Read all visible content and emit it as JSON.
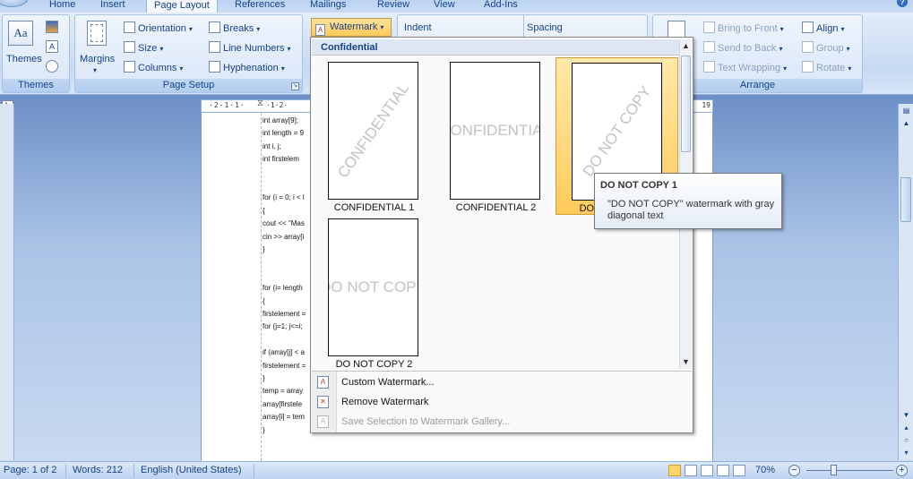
{
  "tabs": [
    "Home",
    "Insert",
    "Page Layout",
    "References",
    "Mailings",
    "Review",
    "View",
    "Add-Ins"
  ],
  "active_tab": "Page Layout",
  "ribbon": {
    "themes": {
      "button_label": "Themes",
      "group_label": "Themes"
    },
    "page_setup": {
      "margins_label": "Margins",
      "orientation_label": "Orientation",
      "size_label": "Size",
      "columns_label": "Columns",
      "breaks_label": "Breaks",
      "line_numbers_label": "Line Numbers",
      "hyphenation_label": "Hyphenation",
      "group_label": "Page Setup"
    },
    "page_background": {
      "watermark_label": "Watermark"
    },
    "paragraph": {
      "indent_label": "Indent",
      "spacing_label": "Spacing"
    },
    "arrange": {
      "bring_to_front_label": "Bring to Front",
      "send_to_back_label": "Send to Back",
      "text_wrapping_label": "Text Wrapping",
      "align_label": "Align",
      "group_btn_label": "Group",
      "rotate_label": "Rotate",
      "group_label": "Arrange"
    }
  },
  "watermark_gallery": {
    "category": "Confidential",
    "items": [
      {
        "label": "CONFIDENTIAL 1",
        "watermark_text": "CONFIDENTIAL",
        "orientation": "diagonal"
      },
      {
        "label": "CONFIDENTIAL 2",
        "watermark_text": "CONFIDENTIAL",
        "orientation": "horizontal"
      },
      {
        "label": "DO NOT COPY 1",
        "watermark_text": "DO NOT COPY",
        "orientation": "diagonal"
      },
      {
        "label": "DO NOT COPY 2",
        "watermark_text": "DO NOT COPY",
        "orientation": "horizontal"
      }
    ],
    "selected_index": 2,
    "menu": {
      "custom_watermark": "Custom Watermark...",
      "remove_watermark": "Remove Watermark",
      "save_selection": "Save Selection to Watermark Gallery..."
    }
  },
  "tooltip": {
    "title": "DO NOT COPY 1",
    "body": "\"DO NOT COPY\" watermark with gray diagonal text"
  },
  "ruler": {
    "left_numbers": "·2·1·1·",
    "marker": "·1·2·",
    "right_number": "19"
  },
  "document": {
    "code_lines": [
      "int array[9];",
      "int length = 9",
      "int i, j;",
      "int firstelem",
      "",
      "",
      "for (i = 0; i < l",
      "{",
      "cout << \"Mas",
      "cin >> array[i",
      "}",
      "",
      "",
      "for (i= length",
      "{",
      "firstelement =",
      "for (j=1; j<=i;",
      "",
      "if (array[j] < a",
      "firstelement =",
      "}",
      "temp = array",
      "array[firstele",
      "array[i] = tem",
      "}"
    ]
  },
  "status_bar": {
    "page": "Page: 1 of 2",
    "words": "Words: 212",
    "language": "English (United States)",
    "zoom": "70%"
  },
  "colors": {
    "ribbon_background": "#d6e4f7",
    "selection_highlight": "#ffcb5a",
    "document_background": "#a9c3e6"
  }
}
